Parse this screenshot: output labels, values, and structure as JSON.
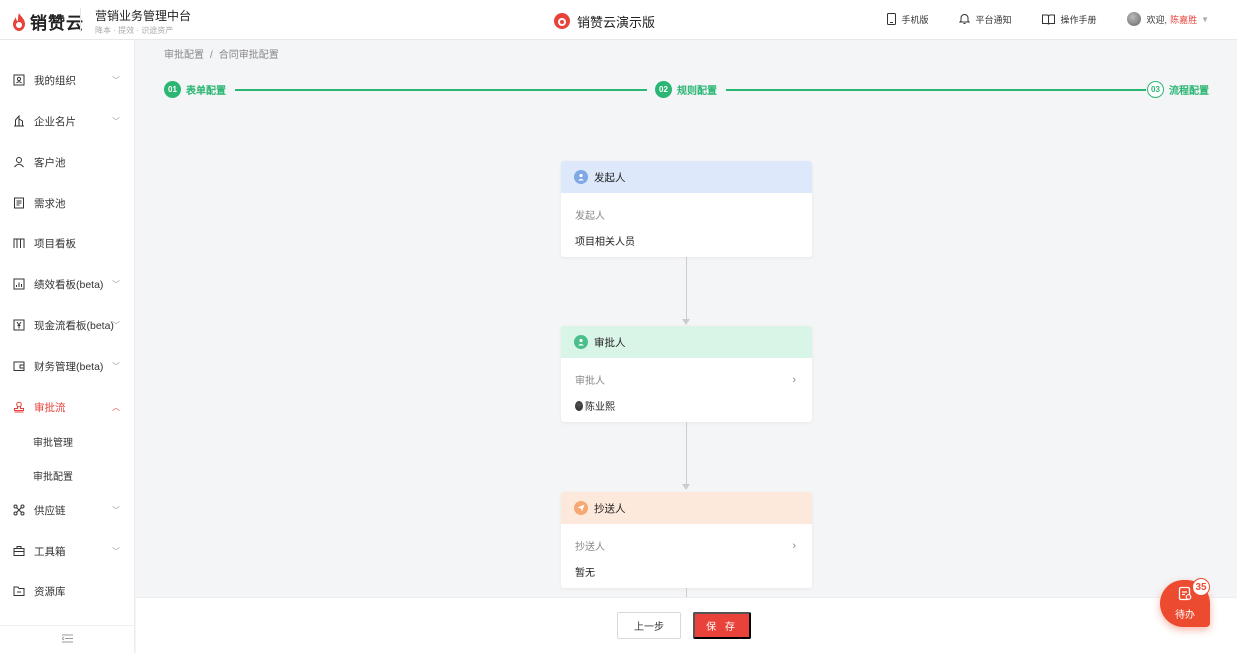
{
  "header": {
    "logo_text": "销赞云",
    "system_title": "营销业务管理中台",
    "system_tagline": "降本 · 提效 · 识途资产",
    "center_title": "销赞云演示版",
    "mobile_label": "手机版",
    "notify_label": "平台通知",
    "manual_label": "操作手册",
    "welcome_label": "欢迎,",
    "user_name": "陈嘉胜"
  },
  "sidebar": {
    "items": [
      {
        "label": "我的组织",
        "icon": "org-icon",
        "has_children": true
      },
      {
        "label": "企业名片",
        "icon": "building-icon",
        "has_children": true
      },
      {
        "label": "客户池",
        "icon": "user-icon",
        "has_children": false
      },
      {
        "label": "需求池",
        "icon": "document-icon",
        "has_children": false
      },
      {
        "label": "项目看板",
        "icon": "kanban-icon",
        "has_children": false
      },
      {
        "label": "绩效看板(beta)",
        "icon": "chart-icon",
        "has_children": true
      },
      {
        "label": "现金流看板(beta)",
        "icon": "yen-icon",
        "has_children": true
      },
      {
        "label": "财务管理(beta)",
        "icon": "wallet-icon",
        "has_children": true
      },
      {
        "label": "审批流",
        "icon": "stamp-icon",
        "has_children": true,
        "active": true
      },
      {
        "label": "供应链",
        "icon": "network-icon",
        "has_children": true
      },
      {
        "label": "工具箱",
        "icon": "toolbox-icon",
        "has_children": true
      },
      {
        "label": "资源库",
        "icon": "folder-icon",
        "has_children": false
      }
    ],
    "sub_items": [
      "审批管理",
      "审批配置"
    ]
  },
  "breadcrumb": [
    "审批配置",
    "合同审批配置"
  ],
  "steps": [
    {
      "num": "01",
      "label": "表单配置"
    },
    {
      "num": "02",
      "label": "规则配置"
    },
    {
      "num": "03",
      "label": "流程配置"
    }
  ],
  "flow": [
    {
      "title": "发起人",
      "label": "发起人",
      "value": "项目相关人员",
      "head_color": "#dde9fb",
      "icon_color": "#7fa8e6"
    },
    {
      "title": "审批人",
      "label": "审批人",
      "value": "陈业熙",
      "head_color": "#d9f5e8",
      "icon_color": "#49c08a"
    },
    {
      "title": "抄送人",
      "label": "抄送人",
      "value": "暂无",
      "head_color": "#fde8dc",
      "icon_color": "#f5a872"
    }
  ],
  "footer": {
    "prev_label": "上一步",
    "save_label": "保 存"
  },
  "todo": {
    "label": "待办",
    "count": "35"
  }
}
